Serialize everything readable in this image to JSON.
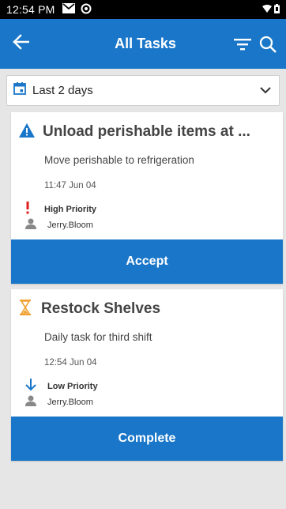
{
  "status_bar": {
    "time": "12:54 PM"
  },
  "app_bar": {
    "title": "All Tasks"
  },
  "filter": {
    "selected": "Last 2 days"
  },
  "tasks": [
    {
      "title": "Unload perishable items at ...",
      "description": "Move perishable to refrigeration",
      "time": "11:47  Jun 04",
      "priority": "High Priority",
      "assignee": "Jerry.Bloom",
      "action": "Accept",
      "status_icon": "warning-triangle-icon",
      "priority_icon": "exclamation-icon"
    },
    {
      "title": "Restock Shelves",
      "description": "Daily task for third shift",
      "time": "12:54  Jun 04",
      "priority": "Low Priority",
      "assignee": "Jerry.Bloom",
      "action": "Complete",
      "status_icon": "hourglass-icon",
      "priority_icon": "arrow-down-icon"
    }
  ],
  "colors": {
    "primary": "#1976c8",
    "warning_blue": "#1976c8",
    "hourglass": "#f0a030",
    "high_priority": "#e0201f"
  }
}
